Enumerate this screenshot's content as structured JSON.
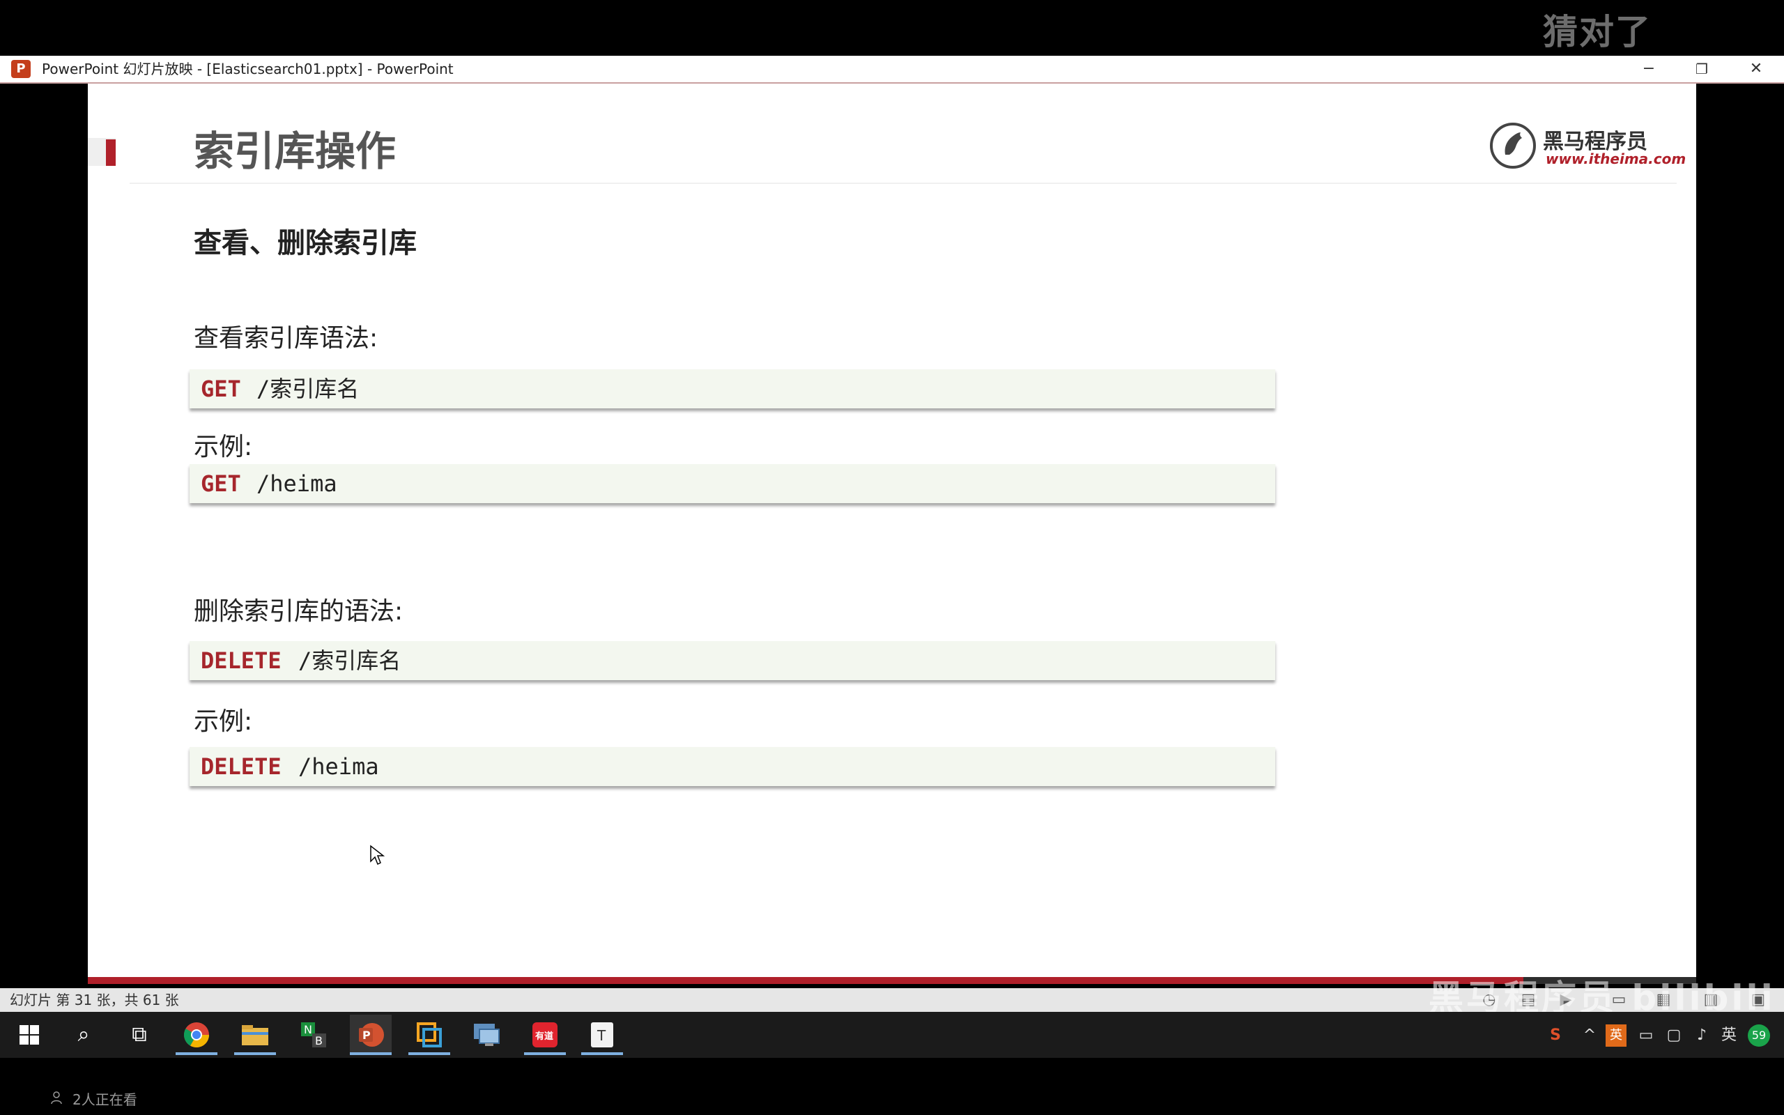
{
  "overlay": {
    "caption": "猜对了"
  },
  "window": {
    "title": "PowerPoint 幻灯片放映 - [Elasticsearch01.pptx] - PowerPoint",
    "app_icon": "P",
    "minimize_icon": "−",
    "restore_icon": "❐",
    "close_icon": "✕"
  },
  "slide": {
    "title": "索引库操作",
    "logo": {
      "cn": "黑马程序员",
      "url": "www.itheima.com"
    },
    "section_heading": "查看、删除索引库",
    "blocks": [
      {
        "label": "查看索引库语法:",
        "keyword": "GET",
        "arg": "/索引库名"
      },
      {
        "label": "示例:",
        "keyword": "GET",
        "arg": "/heima"
      },
      {
        "label": "删除索引库的语法:",
        "keyword": "DELETE",
        "arg": "/索引库名"
      },
      {
        "label": "示例:",
        "keyword": "DELETE",
        "arg": "/heima"
      }
    ]
  },
  "status": {
    "text": "幻灯片 第 31 张，共 61 张"
  },
  "watermark": "黑马程序员 bilibili",
  "taskbar": {
    "search_icon": "⌕",
    "taskview_icon": "⧉",
    "tray": {
      "ime": "英",
      "ime2": "英",
      "badge": "59"
    }
  },
  "viewers": "2人正在看",
  "colors": {
    "accent_red": "#b0202a",
    "keyword": "#a6262c",
    "code_bg": "#f3f7ef"
  }
}
